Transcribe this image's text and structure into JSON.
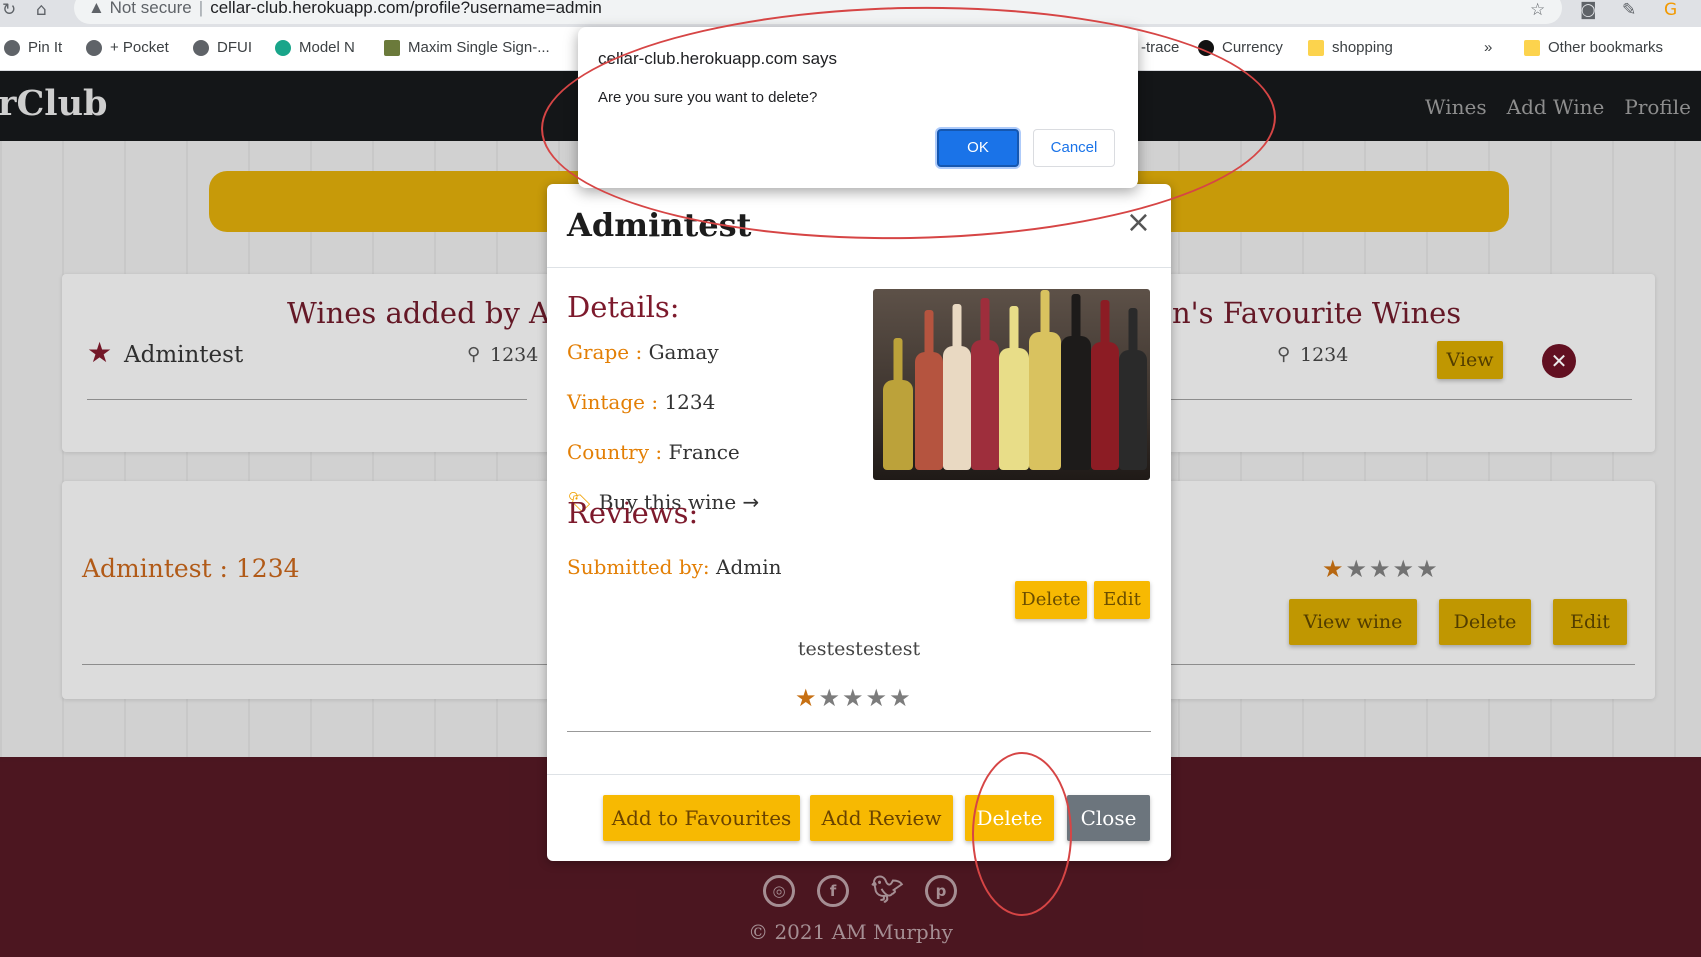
{
  "browser": {
    "security_label": "Not secure",
    "url": "cellar-club.herokuapp.com/profile?username=admin",
    "bookmarks": [
      "Pin It",
      "+ Pocket",
      "DFUI",
      "Model N",
      "Maxim Single Sign-...",
      "-trace",
      "Currency",
      "shopping"
    ],
    "overflow_chevron": "»",
    "other_bookmarks": "Other bookmarks"
  },
  "site": {
    "brand": "rClub",
    "nav": [
      "Wines",
      "Add Wine",
      "Profile"
    ]
  },
  "page": {
    "wines_added_title": "Wines added by Ad",
    "wine_row": {
      "name": "Admintest",
      "vintage": "1234"
    },
    "favourites_title": "n's Favourite Wines",
    "fav_row": {
      "vintage": "1234",
      "view_button": "View"
    },
    "review_card": {
      "title": "Admintest : 1234",
      "rating": 1,
      "view_wine_button": "View wine",
      "delete_button": "Delete",
      "edit_button": "Edit"
    }
  },
  "modal": {
    "title": "Admintest",
    "close_glyph": "×",
    "details_heading": "Details:",
    "grape_label": "Grape :",
    "grape": "Gamay",
    "vintage_label": "Vintage :",
    "vintage": "1234",
    "country_label": "Country :",
    "country": "France",
    "buy_link": "Buy this wine",
    "reviews_heading": "Reviews:",
    "submitted_by_label": "Submitted by:",
    "submitted_by": "Admin",
    "review_delete": "Delete",
    "review_edit": "Edit",
    "review_text": "testestestest",
    "review_rating": 1,
    "buttons": {
      "add_favourites": "Add to Favourites",
      "add_review": "Add Review",
      "delete": "Delete",
      "close": "Close"
    }
  },
  "alert": {
    "title": "cellar-club.herokuapp.com says",
    "message": "Are you sure you want to delete?",
    "ok": "OK",
    "cancel": "Cancel"
  },
  "footer": {
    "copyright": "© 2021 AM Murphy",
    "social_icons": [
      "instagram-icon",
      "facebook-icon",
      "twitter-icon",
      "pinterest-icon"
    ]
  },
  "colors": {
    "header": "#16181b",
    "accent_gold": "#f7b902",
    "burgundy": "#7d1a2c",
    "orange_label": "#e37f05",
    "footer": "#521823",
    "alert_blue": "#1a73e8",
    "annotation_red": "#d64545"
  }
}
